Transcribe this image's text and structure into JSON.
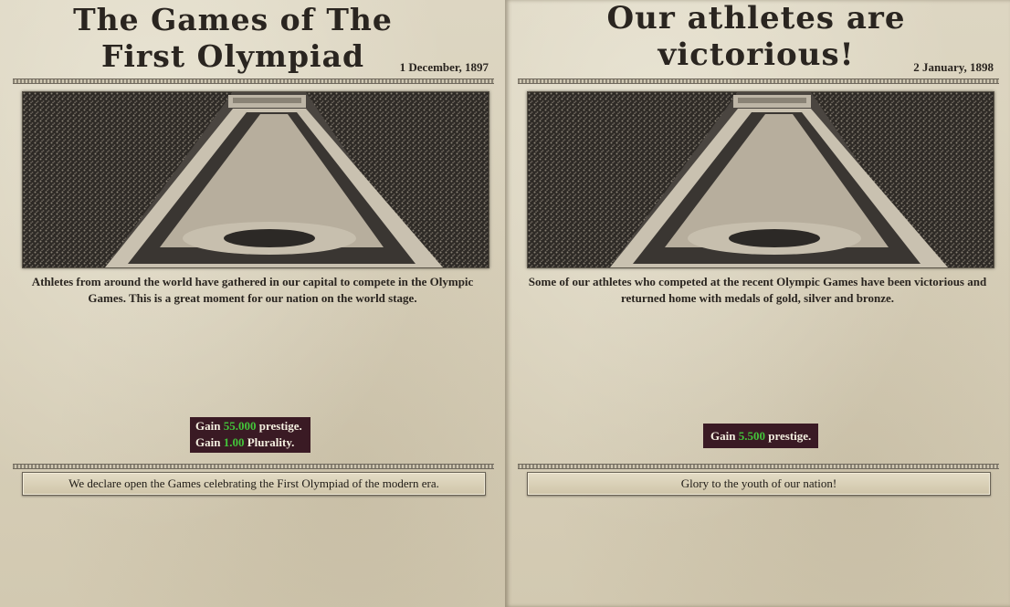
{
  "events": [
    {
      "title": "The Games of The First Olympiad",
      "date": "1 December, 1897",
      "description": "Athletes from around the world have gathered in our capital to compete in the Olympic Games. This is a great moment for our nation on the world stage.",
      "effects": [
        {
          "prefix": "Gain ",
          "value": "55.000",
          "suffix": " prestige."
        },
        {
          "prefix": "Gain ",
          "value": "1.00",
          "suffix": " Plurality."
        }
      ],
      "option": "We declare open the Games celebrating the First Olympiad of the modern era."
    },
    {
      "title": "Our athletes are victorious!",
      "date": "2 January, 1898",
      "description": "Some of our athletes who competed at the recent Olympic Games have been victorious and returned home with medals of gold, silver and bronze.",
      "effects": [
        {
          "prefix": "Gain ",
          "value": "5.500",
          "suffix": " prestige."
        }
      ],
      "option": "Glory to the youth of our nation!"
    }
  ],
  "colors": {
    "effect_bg": "#3a1a24",
    "effect_value": "#43c43a",
    "parchment": "#d8d0ba"
  }
}
